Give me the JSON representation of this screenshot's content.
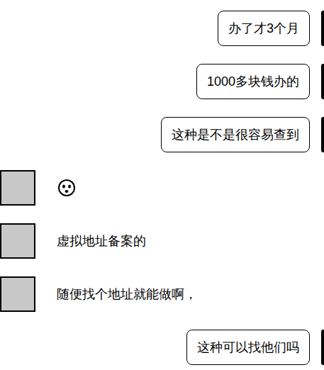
{
  "messages": [
    {
      "side": "right",
      "kind": "text",
      "text": "办了才3个月"
    },
    {
      "side": "right",
      "kind": "text",
      "text": "1000多块钱办的"
    },
    {
      "side": "right",
      "kind": "text",
      "text": "这种是不是很容易查到"
    },
    {
      "side": "left",
      "kind": "emoji",
      "text": ""
    },
    {
      "side": "left",
      "kind": "text",
      "text": "虚拟地址备案的"
    },
    {
      "side": "left",
      "kind": "text",
      "text": "随便找个地址就能做啊，"
    },
    {
      "side": "right",
      "kind": "text",
      "text": "这种可以找他们吗"
    }
  ]
}
